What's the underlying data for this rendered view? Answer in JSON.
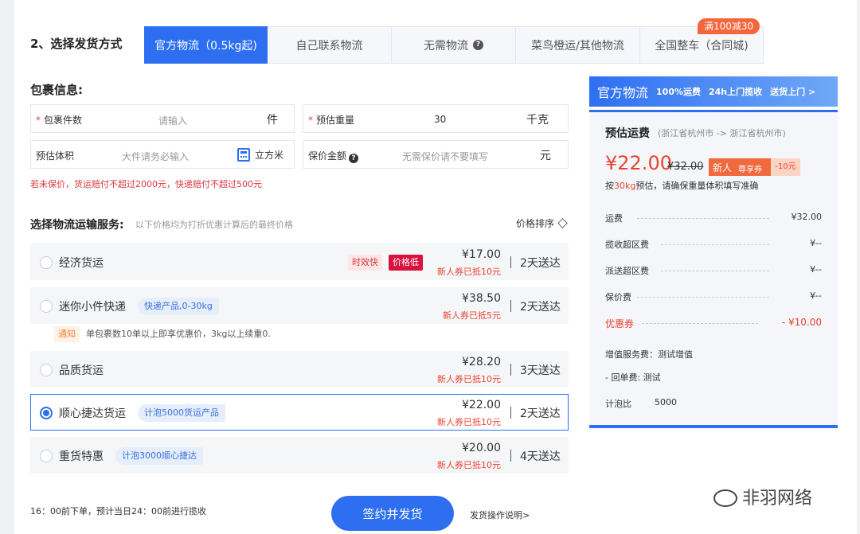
{
  "section_title": "2、选择发货方式",
  "tabs": [
    {
      "label": "官方物流（0.5kg起)",
      "active": true
    },
    {
      "label": "自己联系物流"
    },
    {
      "label": "无需物流"
    },
    {
      "label": "菜鸟橙运/其他物流"
    },
    {
      "label": "全国整车（合同城)"
    }
  ],
  "tab_badge": "满100减30",
  "package": {
    "title": "包裹信息:",
    "count_label": "包裹件数",
    "count_placeholder": "请输入",
    "count_unit": "件",
    "weight_label": "预估重量",
    "weight_value": "30",
    "weight_unit": "千克",
    "volume_label": "预估体积",
    "volume_placeholder": "大件请务必输入",
    "volume_unit": "立方米",
    "insure_label": "保价金额",
    "insure_placeholder": "无需保价请不要填写",
    "insure_unit": "元",
    "warning": "若未保价，货运赔付不超过2000元，快递赔付不超过500元"
  },
  "service": {
    "title": "选择物流运输服务:",
    "note": "以下价格均为打折优惠计算后的最终价格",
    "sort_label": "价格排序",
    "rows": [
      {
        "name": "经济货运",
        "tag_fast": "时效快",
        "tag_low": "价格低",
        "price": "¥17.00",
        "coupon": "新人券已抵10元",
        "days": "2天送达"
      },
      {
        "name": "迷你小件快递",
        "chip": "快递产品,0-30kg",
        "price": "¥38.50",
        "coupon": "新人券已抵5元",
        "days": "2天送达"
      },
      {
        "name": "品质货运",
        "price": "¥28.20",
        "coupon": "新人券已抵10元",
        "days": "3天送达"
      },
      {
        "name": "顺心捷达货运",
        "chip": "计泡5000货运产品",
        "price": "¥22.00",
        "coupon": "新人券已抵10元",
        "days": "2天送达"
      },
      {
        "name": "重货特惠",
        "chip": "计泡3000顺心捷达",
        "price": "¥20.00",
        "coupon": "新人券已抵10元",
        "days": "4天送达"
      }
    ],
    "notice_tag": "通知",
    "notice_text": "单包裹数10单以上即享优惠价，3kg以上续重0."
  },
  "footer": {
    "note": "16：00前下单，预计当日24：00前进行揽收",
    "button": "签约并发货",
    "link": "发货操作说明>"
  },
  "panel": {
    "head_title": "官方物流",
    "head_tag1": "100%运费",
    "head_tag2": "24h上门揽收",
    "head_tag3": "送货上门 >",
    "est_title": "预估运费",
    "route": "(浙江省杭州市 -> 浙江省杭州市)",
    "price": "¥22.00",
    "old_price": "¥32.00",
    "xr_a": "新人",
    "xr_b": "尊享券",
    "xr_c": "-10元",
    "calc_pre": "按",
    "calc_hl": "30kg",
    "calc_post": "预估，请确保重量体积填写准确",
    "fees": [
      {
        "label": "运费",
        "value": "¥32.00"
      },
      {
        "label": "揽收超区费",
        "value": "¥--"
      },
      {
        "label": "派送超区费",
        "value": "¥--"
      },
      {
        "label": "保价费",
        "value": "¥--"
      },
      {
        "label": "优惠券",
        "value": "- ¥10.00"
      }
    ],
    "addon_title": "增值服务费：测试增值",
    "addon_item": "- 回单费: 测试",
    "bubble_label": "计泡比",
    "bubble_value": "5000"
  },
  "watermark": "非羽网络"
}
